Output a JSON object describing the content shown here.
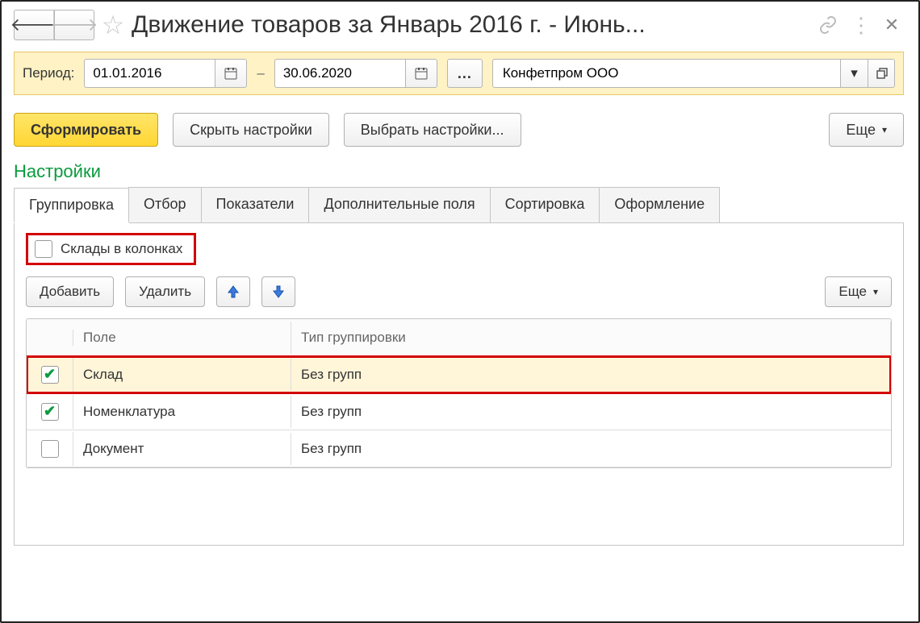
{
  "title": "Движение товаров  за Январь 2016 г. - Июнь...",
  "period": {
    "label": "Период:",
    "date_from": "01.01.2016",
    "dash": "–",
    "date_to": "30.06.2020",
    "ellipsis": "...",
    "organization": "Конфетпром ООО"
  },
  "buttons": {
    "generate": "Сформировать",
    "hide_settings": "Скрыть настройки",
    "choose_settings": "Выбрать настройки...",
    "more": "Еще"
  },
  "settings_title": "Настройки",
  "tabs": {
    "grouping": "Группировка",
    "filter": "Отбор",
    "indicators": "Показатели",
    "extra_fields": "Дополнительные поля",
    "sorting": "Сортировка",
    "design": "Оформление"
  },
  "columns_checkbox": "Склады в колонках",
  "inner_toolbar": {
    "add": "Добавить",
    "delete": "Удалить",
    "more": "Еще"
  },
  "table": {
    "headers": {
      "field": "Поле",
      "type": "Тип группировки"
    },
    "rows": [
      {
        "checked": true,
        "field": "Склад",
        "type": "Без групп",
        "selected": true,
        "highlight": true
      },
      {
        "checked": true,
        "field": "Номенклатура",
        "type": "Без групп",
        "selected": false,
        "highlight": false
      },
      {
        "checked": false,
        "field": "Документ",
        "type": "Без групп",
        "selected": false,
        "highlight": false
      }
    ]
  }
}
